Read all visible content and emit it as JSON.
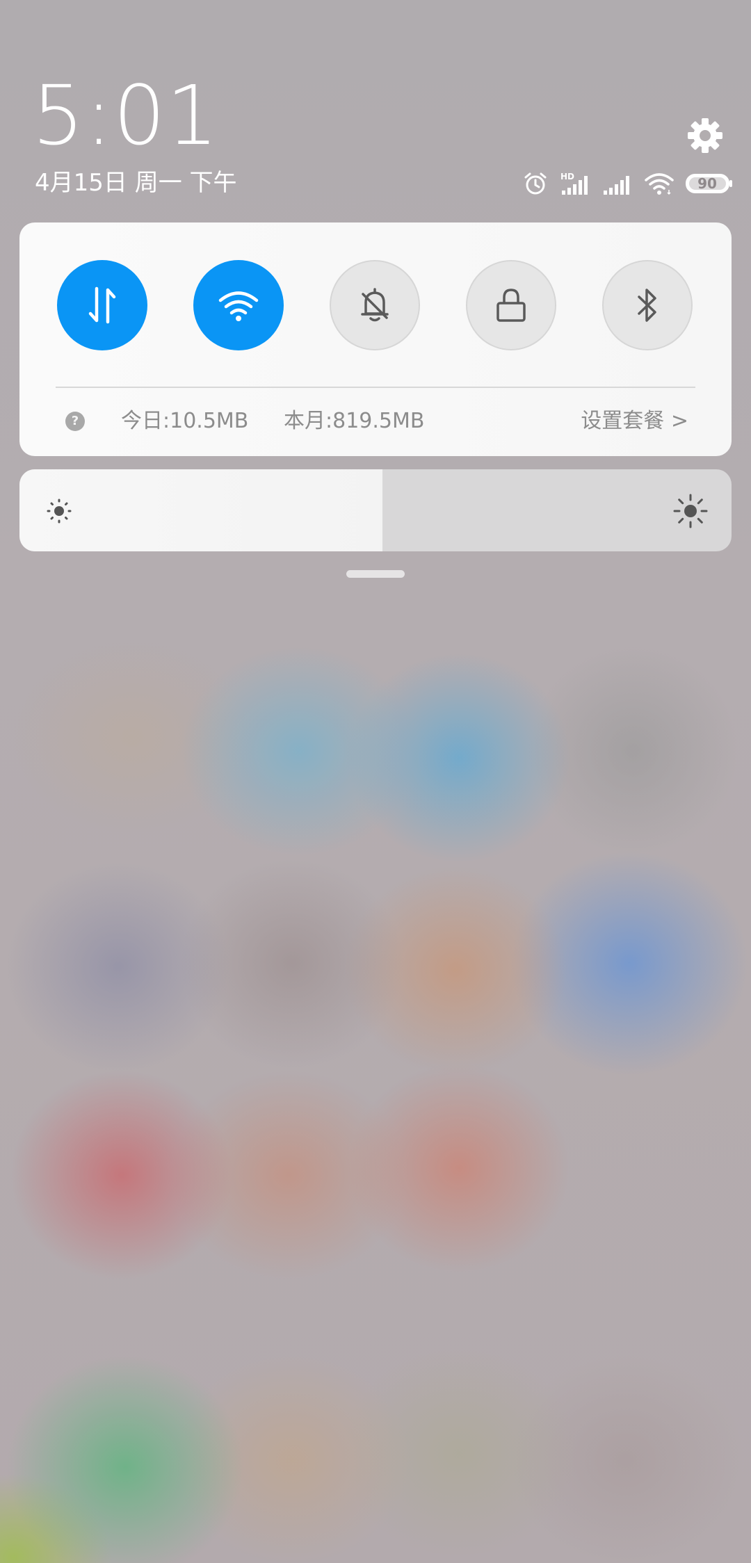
{
  "status": {
    "time": "5:01",
    "date": "4月15日 周一 下午",
    "battery_level": "90",
    "network_badge": "HD"
  },
  "quick_toggles": [
    {
      "name": "mobile-data",
      "state": "on"
    },
    {
      "name": "wifi",
      "state": "on"
    },
    {
      "name": "silent",
      "state": "off"
    },
    {
      "name": "lock-screen",
      "state": "off"
    },
    {
      "name": "bluetooth",
      "state": "off"
    }
  ],
  "data_usage": {
    "help_glyph": "?",
    "today": "今日:10.5MB",
    "this_month": "本月:819.5MB",
    "set_plan": "设置套餐 >"
  },
  "brightness": {
    "level": 0.51
  },
  "colors": {
    "accent": "#0a95f5",
    "toggle_off": "#e6e6e6",
    "card_bg": "#f8f8f8"
  }
}
